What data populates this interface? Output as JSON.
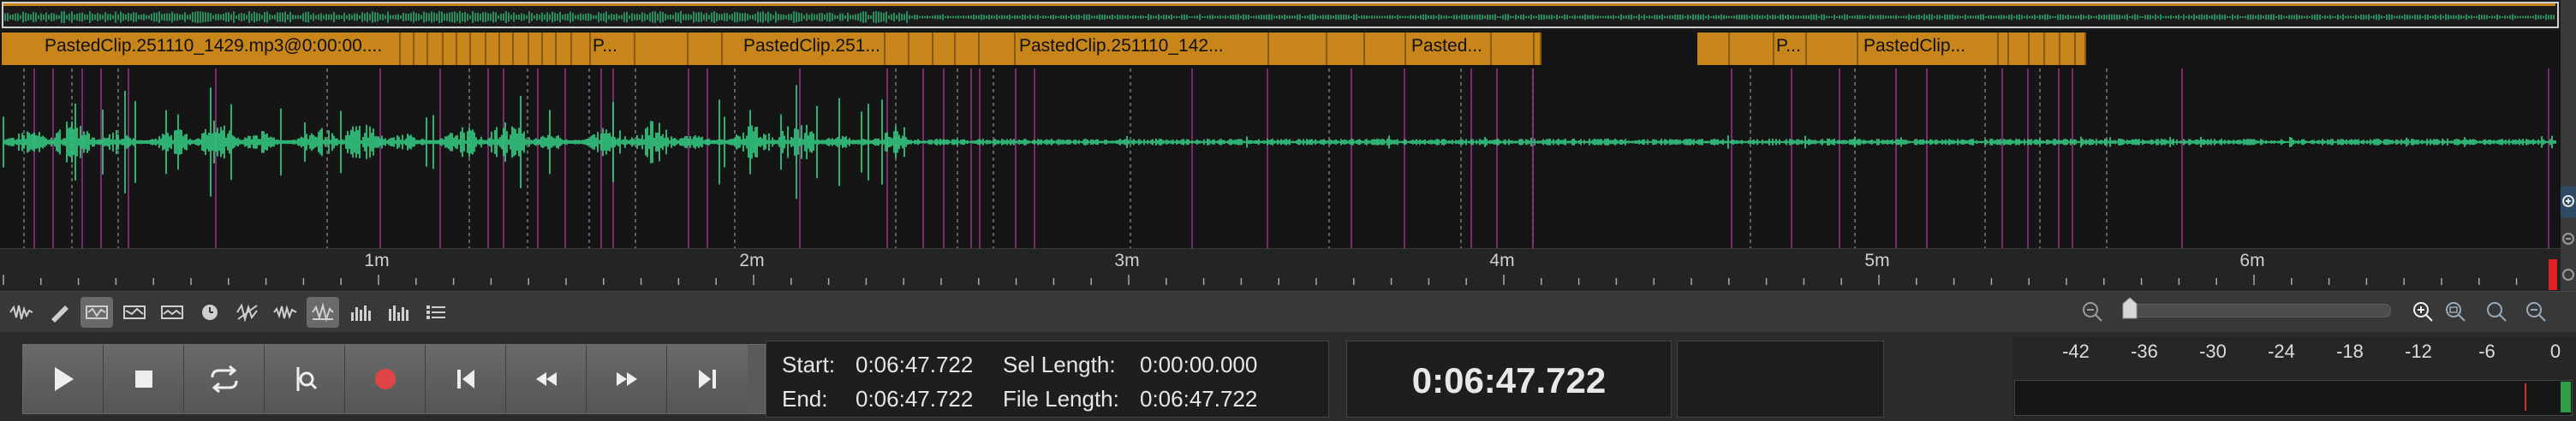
{
  "colors": {
    "waveform": "#35d98a",
    "clip": "#c8861a",
    "marker_magenta": "#a0308f",
    "record": "#e04545",
    "meter_peak": "#c0392b"
  },
  "clips": [
    {
      "label": "PastedClip.251110_1429.mp3@0:00:00...."
    },
    {
      "label": "P..."
    },
    {
      "label": "PastedClip.251..."
    },
    {
      "label": "PastedClip.251110_142..."
    },
    {
      "label": "Pasted..."
    },
    {
      "label": "P..."
    },
    {
      "label": "PastedClip..."
    }
  ],
  "ruler": {
    "labels": [
      "1m",
      "2m",
      "3m",
      "4m",
      "5m",
      "6m"
    ]
  },
  "side_buttons": [
    "zoom-in-icon",
    "zoom-out-icon",
    "zoom-fit-icon"
  ],
  "tools": [
    "waveform-view-icon",
    "pencil-icon",
    "spectral-icon",
    "spectral-icon",
    "spectral-icon",
    "clock-icon",
    "noise-icon",
    "waveform-icon",
    "spectrum-icon",
    "bars-icon",
    "bars-icon",
    "list-icon"
  ],
  "transport": {
    "buttons": [
      "play-icon",
      "stop-icon",
      "loop-icon",
      "scrub-icon",
      "record-icon",
      "skip-start-icon",
      "rewind-icon",
      "fast-forward-icon",
      "skip-end-icon"
    ]
  },
  "info": {
    "start_label": "Start:",
    "start_value": "0:06:47.722",
    "end_label": "End:",
    "end_value": "0:06:47.722",
    "sel_length_label": "Sel Length:",
    "sel_length_value": "0:00:00.000",
    "file_length_label": "File Length:",
    "file_length_value": "0:06:47.722"
  },
  "current_time": "0:06:47.722",
  "meter": {
    "labels": [
      "-42",
      "-36",
      "-30",
      "-24",
      "-18",
      "-12",
      "-6",
      "0"
    ]
  }
}
